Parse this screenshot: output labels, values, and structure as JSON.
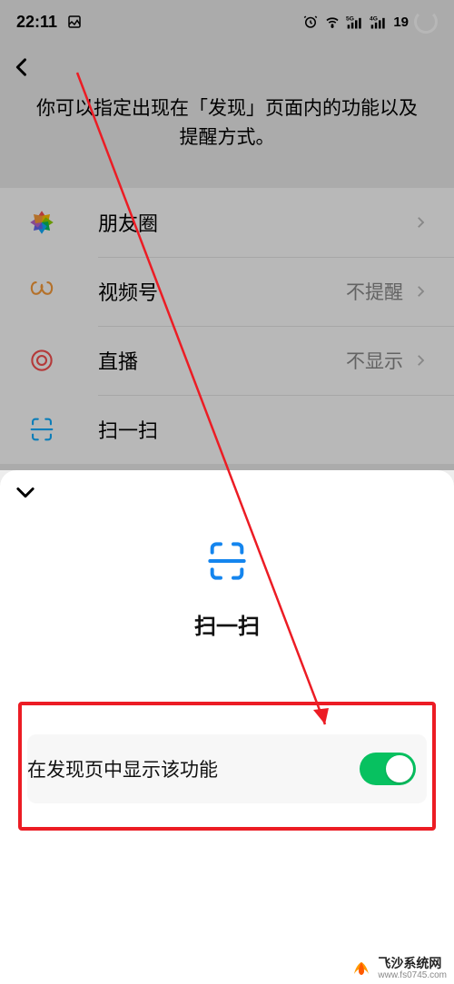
{
  "status": {
    "time": "22:11",
    "battery": "19"
  },
  "subtitle": "你可以指定出现在「发现」页面内的功能以及提醒方式。",
  "list": {
    "items": [
      {
        "label": "朋友圈",
        "value": ""
      },
      {
        "label": "视频号",
        "value": "不提醒"
      },
      {
        "label": "直播",
        "value": "不显示"
      },
      {
        "label": "扫一扫",
        "value": ""
      }
    ]
  },
  "sheet": {
    "title": "扫一扫",
    "toggle_label": "在发现页中显示该功能",
    "toggle_on": true
  },
  "watermark": {
    "name": "飞沙系统网",
    "url": "www.fs0745.com"
  },
  "colors": {
    "accent_green": "#07c160",
    "annotation_red": "#ec1c24"
  }
}
